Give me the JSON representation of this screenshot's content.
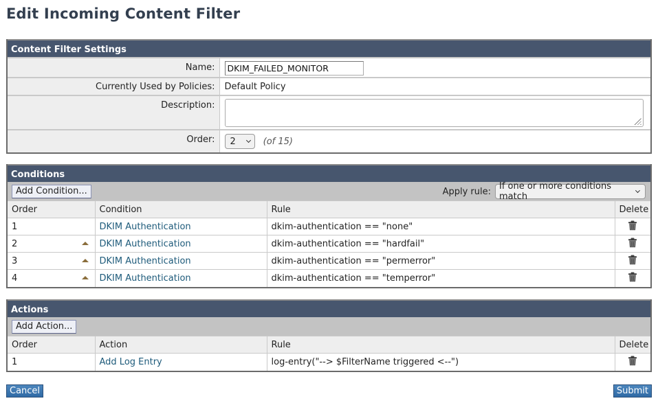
{
  "page": {
    "title": "Edit Incoming Content Filter"
  },
  "settings": {
    "header": "Content Filter Settings",
    "name_label": "Name:",
    "name_value": "DKIM_FAILED_MONITOR",
    "policies_label": "Currently Used by Policies:",
    "policies_value": "Default Policy",
    "description_label": "Description:",
    "description_value": "",
    "order_label": "Order:",
    "order_value": "2",
    "order_total": "(of 15)"
  },
  "conditions": {
    "header": "Conditions",
    "add_button": "Add Condition...",
    "apply_rule_label": "Apply rule:",
    "apply_rule_value": "If one or more conditions match",
    "columns": [
      "Order",
      "Condition",
      "Rule",
      "Delete"
    ],
    "rows": [
      {
        "order": "1",
        "condition": "DKIM Authentication",
        "rule": "dkim-authentication == \"none\"",
        "move_up": false
      },
      {
        "order": "2",
        "condition": "DKIM Authentication",
        "rule": "dkim-authentication == \"hardfail\"",
        "move_up": true
      },
      {
        "order": "3",
        "condition": "DKIM Authentication",
        "rule": "dkim-authentication == \"permerror\"",
        "move_up": true
      },
      {
        "order": "4",
        "condition": "DKIM Authentication",
        "rule": "dkim-authentication == \"temperror\"",
        "move_up": true
      }
    ]
  },
  "actions": {
    "header": "Actions",
    "add_button": "Add Action...",
    "columns": [
      "Order",
      "Action",
      "Rule",
      "Delete"
    ],
    "rows": [
      {
        "order": "1",
        "action": "Add Log Entry",
        "rule": "log-entry(\"--> $FilterName triggered <--\")"
      }
    ]
  },
  "footer": {
    "cancel_label": "Cancel",
    "submit_label": "Submit"
  },
  "colors": {
    "header_bar": "#47566e",
    "link": "#1d5a7a",
    "primary_button": "#3a74ae",
    "title": "#333f4f"
  }
}
